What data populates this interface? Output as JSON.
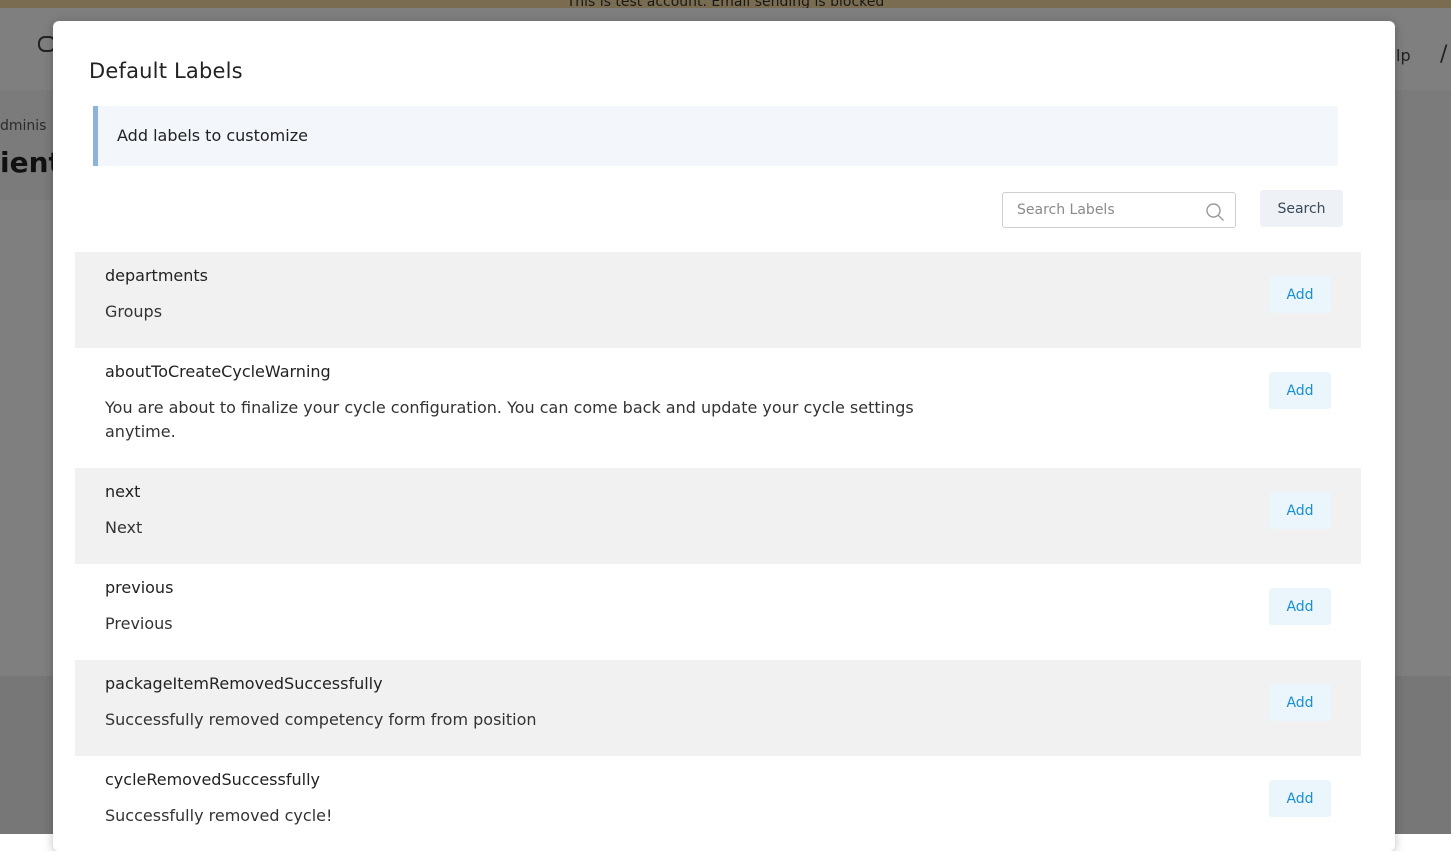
{
  "background": {
    "banner_text": "This is test account. Email sending is blocked",
    "help_text": "lp",
    "breadcrumb_text": "dminis",
    "heading_text": "ient"
  },
  "modal": {
    "title": "Default Labels",
    "info_text": "Add labels to customize",
    "search": {
      "placeholder": "Search Labels",
      "value": "",
      "button_label": "Search"
    },
    "labels": [
      {
        "key": "departments",
        "value": "Groups",
        "action": "Add"
      },
      {
        "key": "aboutToCreateCycleWarning",
        "value": "You are about to finalize your cycle configuration. You can come back and update your cycle settings anytime.",
        "action": "Add"
      },
      {
        "key": "next",
        "value": "Next",
        "action": "Add"
      },
      {
        "key": "previous",
        "value": "Previous",
        "action": "Add"
      },
      {
        "key": "packageItemRemovedSuccessfully",
        "value": "Successfully removed competency form from position",
        "action": "Add"
      },
      {
        "key": "cycleRemovedSuccessfully",
        "value": "Successfully removed cycle!",
        "action": "Add"
      }
    ]
  },
  "colors": {
    "info_border": "#8fb2d9",
    "add_text": "#1a8fd8",
    "row_shade": "#f1f1f1"
  }
}
